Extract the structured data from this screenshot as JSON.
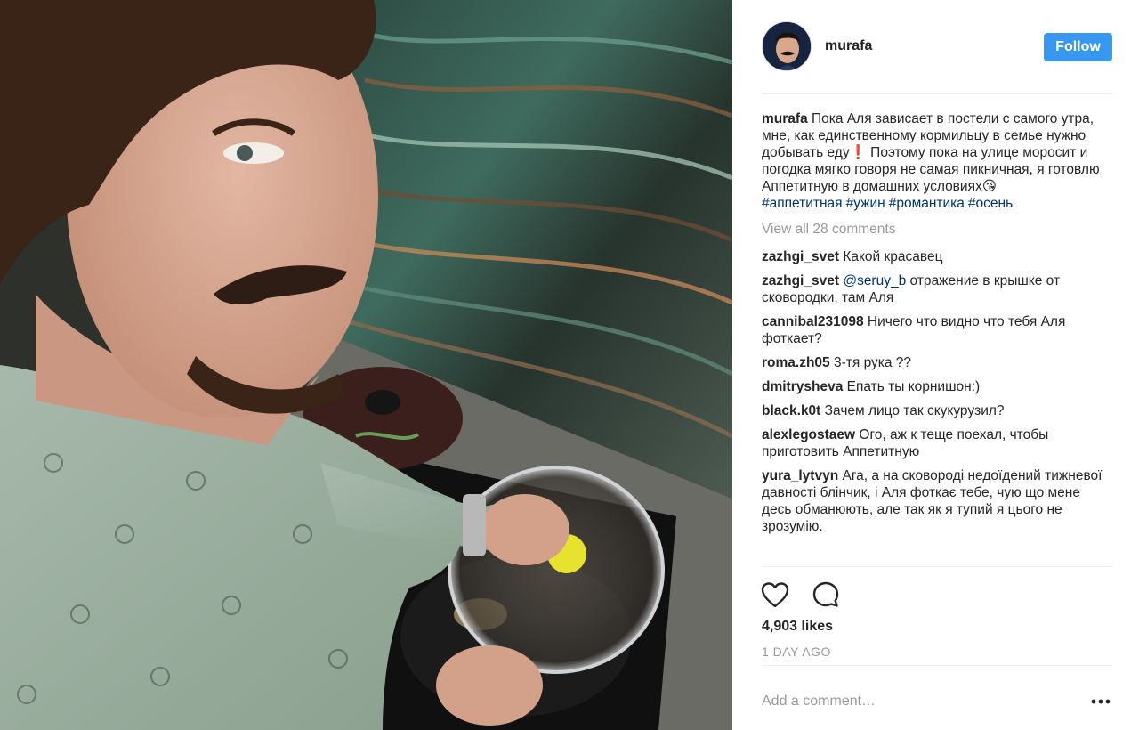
{
  "post": {
    "username": "murafa",
    "follow_label": "Follow",
    "caption": {
      "username": "murafa",
      "text": "Пока Аля зависает в постели с самого утра, мне, как единственному кормильцу в семье нужно добывать еду❗️ Поэтому пока на улице моросит и погодка мягко говоря не самая пикничная, я готовлю Аппетитную в домашних условиях😘",
      "hashtags": [
        "#аппетитная",
        "#ужин",
        "#романтика",
        "#осень"
      ]
    },
    "view_all_comments": "View all 28 comments",
    "comments": [
      {
        "username": "zazhgi_svet",
        "mention": "",
        "text": "Какой красавец"
      },
      {
        "username": "zazhgi_svet",
        "mention": "@seruy_b",
        "text": "отражение в крышке от сковородки, там Аля"
      },
      {
        "username": "cannibal231098",
        "mention": "",
        "text": "Ничего что видно что тебя Аля фоткает?"
      },
      {
        "username": "roma.zh05",
        "mention": "",
        "text": "3-тя рука ??"
      },
      {
        "username": "dmitrysheva",
        "mention": "",
        "text": "Епать ты корнишон:)"
      },
      {
        "username": "black.k0t",
        "mention": "",
        "text": "Зачем лицо так скукурузил?"
      },
      {
        "username": "alexlegostaew",
        "mention": "",
        "text": "Ого, аж к теще поехал, чтобы приготовить Аппетитную"
      },
      {
        "username": "yura_lytvyn",
        "mention": "",
        "text": "Ага, а на сковороді недоїдений тижневої давності блінчик, і Аля фоткає тебе, чую що мене десь обманюють, але так як я тупий я цього не зрозумію."
      }
    ],
    "likes": "4,903 likes",
    "time": "1 DAY AGO",
    "add_comment_placeholder": "Add a comment…",
    "more_label": "•••"
  },
  "icons": {
    "like": "heart-outline",
    "comment": "speech-bubble-outline",
    "more": "ellipsis-horizontal"
  },
  "colors": {
    "follow_button": "#3897f0",
    "hashtag": "#003569",
    "muted": "#999999",
    "text": "#262626"
  }
}
